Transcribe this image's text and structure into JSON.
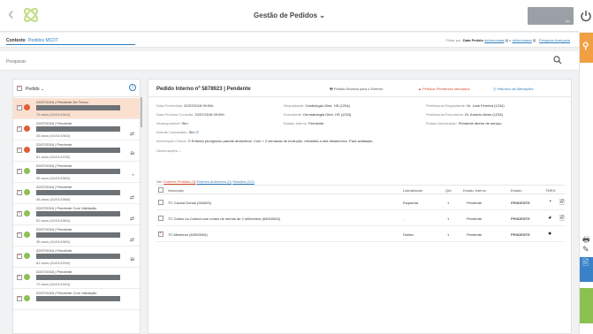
{
  "topbar": {
    "title": "Gestão de Pedidos ⌄",
    "user_label": "Sair"
  },
  "context": {
    "label": "Contexto",
    "value": "Pedidos MCDT",
    "filter_prefix": "Filtrar por:",
    "filter_field": "Data Pedido",
    "date_from": "dd/mm/aaaa",
    "date_to": "dd/mm/aaaa",
    "advanced": "Pesquisa Avançada"
  },
  "search": {
    "placeholder": "Pesquisar"
  },
  "list": {
    "header": "Pedido ⌄",
    "rows": [
      {
        "line1": "22/07/2016 | Pendente De Termo",
        "line3": "72 anos (01/01/1944)",
        "dot": "#e25c3a",
        "icon": "",
        "selected": true
      },
      {
        "line1": "22/07/2016 | Pendente",
        "line3": "45 anos (01/01/1963)",
        "dot": "#e25c3a",
        "icon": "⇄",
        "selected": false
      },
      {
        "line1": "22/07/2016 | Pendente",
        "line3": "81 anos (01/01/1935)",
        "dot": "#e25c3a",
        "icon": "⛿",
        "selected": false
      },
      {
        "line1": "22/07/2016 | Pendente",
        "line3": "36 anos (01/01/1980)",
        "dot": "#8cc152",
        "icon": "◔",
        "selected": false
      },
      {
        "line1": "22/07/2016 | Pendente",
        "line3": "48 anos (01/01/1968)",
        "dot": "#8cc152",
        "icon": "⇄",
        "selected": false
      },
      {
        "line1": "22/07/2016 | Pendente Com Validação",
        "line3": "52 anos (01/01/1964)",
        "dot": "#8cc152",
        "icon": "⇄",
        "selected": false
      },
      {
        "line1": "22/07/2016 | Pendente",
        "line3": "35 anos (01/01/1980)",
        "dot": "#8cc152",
        "icon": "⇄",
        "selected": false
      },
      {
        "line1": "22/07/2016 | Pendente",
        "line3": "81 anos (01/01/1935)",
        "dot": "#8cc152",
        "icon": "⛿",
        "selected": false
      },
      {
        "line1": "22/07/2016 | Pendente",
        "line3": "72 anos (01/01/1944)",
        "dot": "#8cc152",
        "icon": "",
        "selected": false
      },
      {
        "line1": "22/07/2016 | Pendente Com Validação",
        "line3": "",
        "dot": "#8cc152",
        "icon": "",
        "selected": false
      }
    ]
  },
  "detail": {
    "title": "Pedido Interno nº 5878923 | Pendente",
    "actions": {
      "external": "Pedido Enviado para o Exterior",
      "marked": "Pedidos Pendentes Marcados",
      "history": "Histórico de Alterações"
    },
    "info": {
      "data_pretendida_label": "Data Pretendida:",
      "data_pretendida": "22/07/2016 09:00h",
      "requisitante_label": "Requisitante:",
      "requisitante": "Cardiologia Glmt- HS (1234)",
      "prof_req_label": "Profissional Requisitante:",
      "prof_req": "Dr. José Ferreira (1234)",
      "proxima_label": "Data Próxima Consulta:",
      "proxima": "22/07/2016 09:00h",
      "executante_label": "Executante:",
      "executante": "Dermatologia Glmt- HS (1234)",
      "prof_exec_label": "Profissional Executante:",
      "prof_exec": "Dr. António Alves (1234)",
      "transport_label": "Intransportável:",
      "transport": "Sim",
      "estado_interno_label": "Estado Interno:",
      "estado_interno": "Pendente",
      "autorizacao_label": "Estado Autorização:",
      "autorizacao": "Pendente diretor de serviço",
      "contactado_label": "Doente Contactado:",
      "contactado": "Sim",
      "clinica_label": "Informação Clínica:",
      "clinica": "O Eritema pruriginoso parede abdominal. Com > 2 semanas de evolução, refratária a anti-histamínico. Para avaliação.",
      "obs_label": "Observações:",
      "obs": "-"
    },
    "tabs": {
      "prefix": "Ver:",
      "t1": "Exames Pedidos (3)",
      "t2": "Exames Anteriores (2)",
      "t3": "Sessões (1/2)"
    },
    "table": {
      "headers": {
        "desc": "Descrição",
        "lat": "Lateralidade",
        "qtd": "Qtd",
        "estado_int": "Estado Interno",
        "estado": "Estado",
        "tmrg": "TMRG"
      },
      "rows": [
        {
          "desc": "TC Coluna Dorsal (264003)",
          "lat": "Esquerda",
          "qtd": "1",
          "estado_int": "Pendente",
          "estado": "PENDENTE",
          "tmrg": "◔",
          "doc": "🖹",
          "checked": false
        },
        {
          "desc": "TC Crânio ou Coluna com cortes de menos de 2 milímetros (64000003)",
          "lat": "-",
          "qtd": "1",
          "estado_int": "Pendente",
          "estado": "PENDENTE",
          "tmrg": "◕",
          "doc": "🖹",
          "checked": false
        },
        {
          "desc": "TC Membros (64000004)",
          "lat": "Direita",
          "qtd": "1",
          "estado_int": "Pendente",
          "estado": "PENDENTE",
          "tmrg": "●",
          "doc": "",
          "checked": true
        }
      ]
    }
  }
}
